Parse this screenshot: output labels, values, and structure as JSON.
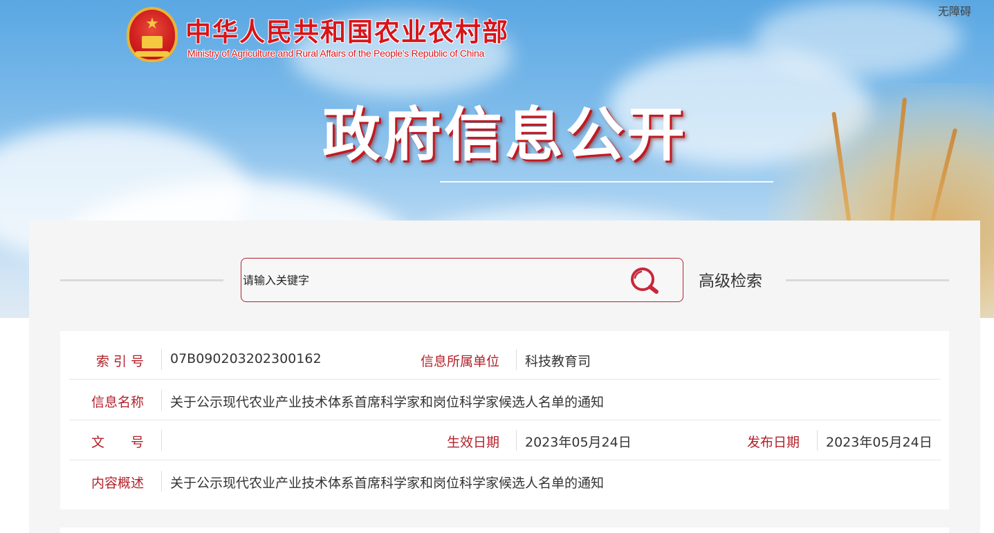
{
  "header": {
    "ministry_cn": "中华人民共和国农业农村部",
    "ministry_en": "Ministry of Agriculture and Rural Affairs of the People's Republic of China",
    "accessibility": "无障碍",
    "hero_title": "政府信息公开"
  },
  "search": {
    "placeholder": "请输入关键字",
    "advanced_label": "高级检索"
  },
  "info": {
    "index_label": "索 引 号",
    "index_value": "07B090203202300162",
    "unit_label": "信息所属单位",
    "unit_value": "科技教育司",
    "name_label": "信息名称",
    "name_value": "关于公示现代农业产业技术体系首席科学家和岗位科学家候选人名单的通知",
    "doc_label": "文　　号",
    "doc_value": "",
    "effective_label": "生效日期",
    "effective_value": "2023年05月24日",
    "publish_label": "发布日期",
    "publish_value": "2023年05月24日",
    "summary_label": "内容概述",
    "summary_value": "关于公示现代农业产业技术体系首席科学家和岗位科学家候选人名单的通知"
  },
  "colors": {
    "brand_red": "#d7151b",
    "label_red": "#b3202a"
  }
}
